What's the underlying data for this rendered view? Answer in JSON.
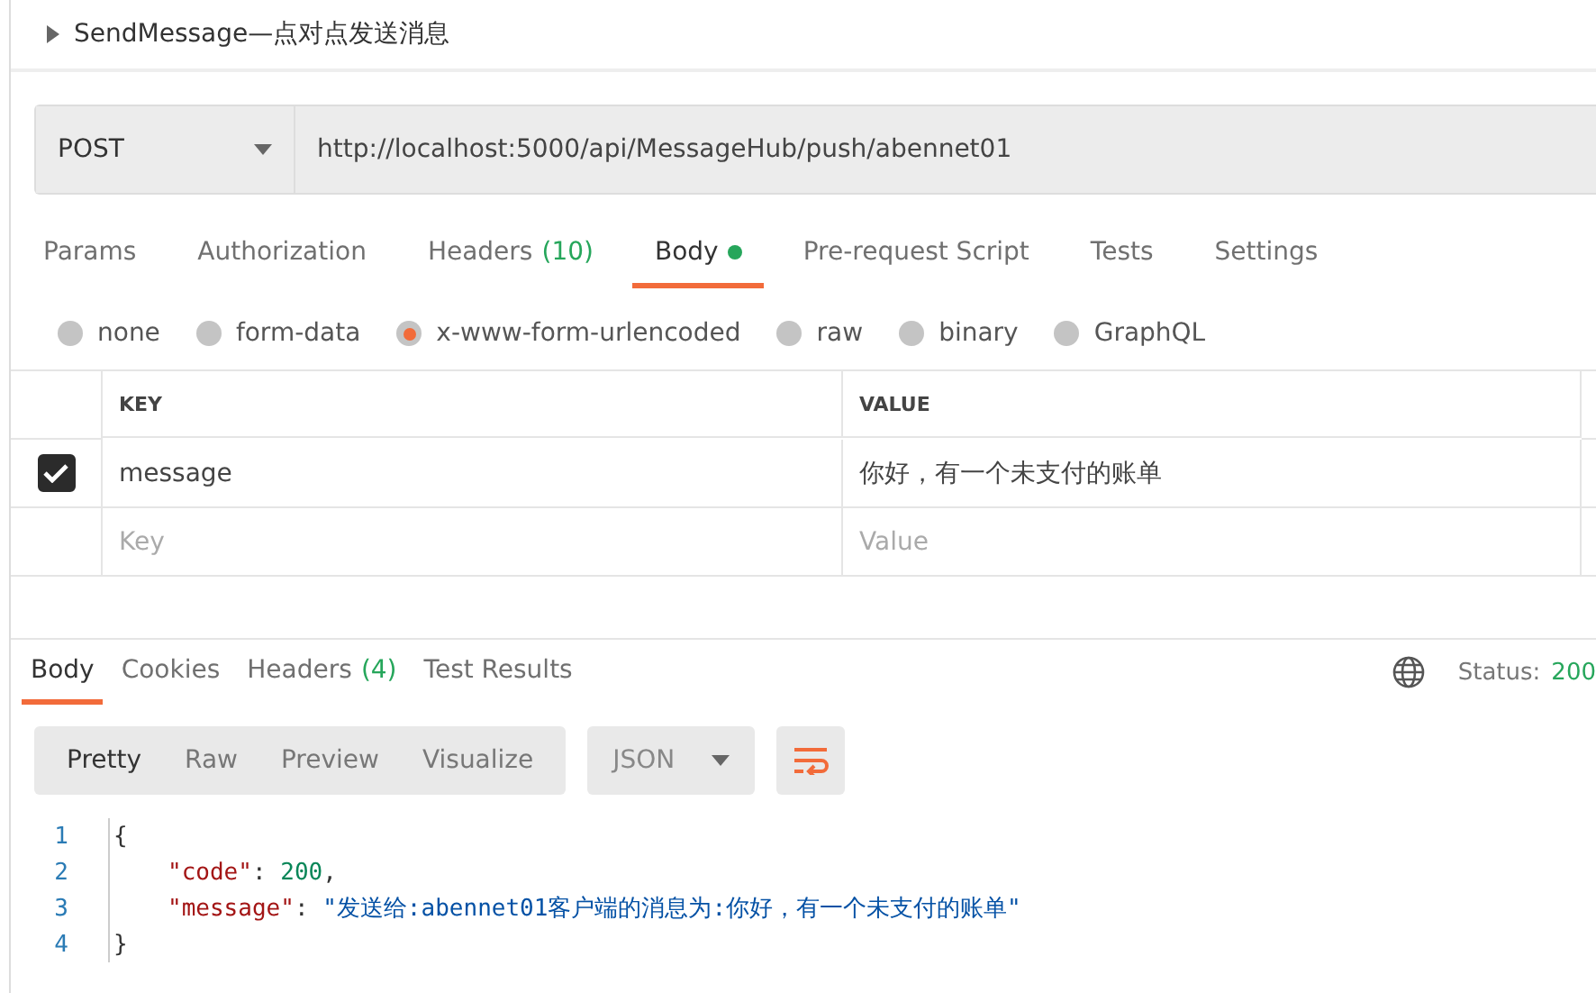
{
  "request": {
    "title": "SendMessage—点对点发送消息",
    "expanded": false,
    "method": "POST",
    "url": "http://localhost:5000/api/MessageHub/push/abennet01"
  },
  "request_tabs": [
    {
      "label": "Params",
      "selected": false
    },
    {
      "label": "Authorization",
      "selected": false
    },
    {
      "label": "Headers",
      "count": "(10)",
      "selected": false
    },
    {
      "label": "Body",
      "dot": true,
      "selected": true
    },
    {
      "label": "Pre-request Script",
      "selected": false
    },
    {
      "label": "Tests",
      "selected": false
    },
    {
      "label": "Settings",
      "selected": false
    }
  ],
  "body_types": [
    {
      "label": "none",
      "selected": false
    },
    {
      "label": "form-data",
      "selected": false
    },
    {
      "label": "x-www-form-urlencoded",
      "selected": true
    },
    {
      "label": "raw",
      "selected": false
    },
    {
      "label": "binary",
      "selected": false
    },
    {
      "label": "GraphQL",
      "selected": false
    }
  ],
  "params_table": {
    "columns": [
      "KEY",
      "VALUE"
    ],
    "rows": [
      {
        "checked": true,
        "key": "message",
        "value": "你好，有一个未支付的账单"
      }
    ],
    "new_row": {
      "key_placeholder": "Key",
      "value_placeholder": "Value"
    }
  },
  "response_tabs": [
    {
      "label": "Body",
      "selected": true
    },
    {
      "label": "Cookies",
      "selected": false
    },
    {
      "label": "Headers",
      "count": "(4)",
      "selected": false
    },
    {
      "label": "Test Results",
      "selected": false
    }
  ],
  "status": {
    "label": "Status:",
    "value": "200"
  },
  "view_modes": [
    {
      "label": "Pretty",
      "selected": true
    },
    {
      "label": "Raw",
      "selected": false
    },
    {
      "label": "Preview",
      "selected": false
    },
    {
      "label": "Visualize",
      "selected": false
    }
  ],
  "format": "JSON",
  "code": [
    {
      "number": "1",
      "tokens": [
        {
          "kind": "punct",
          "text": "{"
        }
      ]
    },
    {
      "number": "2",
      "tokens": [
        {
          "kind": "key",
          "text": "\"code\""
        },
        {
          "kind": "punct",
          "text": ": "
        },
        {
          "kind": "number",
          "text": "200"
        },
        {
          "kind": "punct",
          "text": ","
        }
      ]
    },
    {
      "number": "3",
      "tokens": [
        {
          "kind": "key",
          "text": "\"message\""
        },
        {
          "kind": "punct",
          "text": ": "
        },
        {
          "kind": "string",
          "text": "\"发送给:abennet01客户端的消息为:你好，有一个未支付的账单\""
        }
      ]
    },
    {
      "number": "4",
      "tokens": [
        {
          "kind": "punct",
          "text": "}"
        }
      ]
    }
  ]
}
